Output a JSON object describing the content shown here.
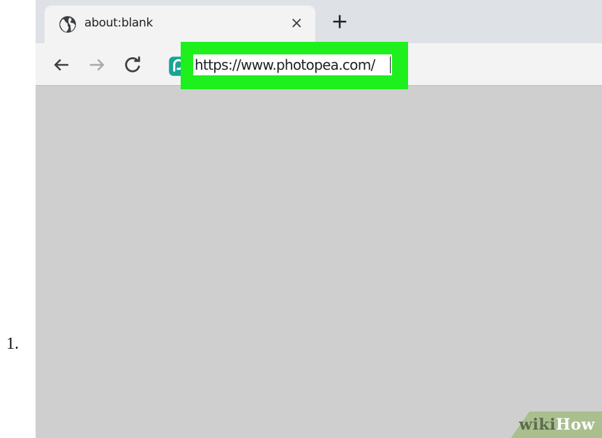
{
  "step": {
    "number": "1."
  },
  "browser": {
    "tab": {
      "title": "about:blank",
      "close_glyph": "×",
      "favicon": "globe-icon"
    },
    "new_tab_glyph": "+",
    "toolbar": {
      "back": "arrow-left-icon",
      "forward": "arrow-right-icon",
      "reload": "reload-icon",
      "site_icon": "photopea-icon"
    },
    "address_bar": {
      "value": "https://www.photopea.com/"
    },
    "highlight_color": "#1ef01e"
  },
  "watermark": {
    "part1": "wiki",
    "part2": "How"
  }
}
